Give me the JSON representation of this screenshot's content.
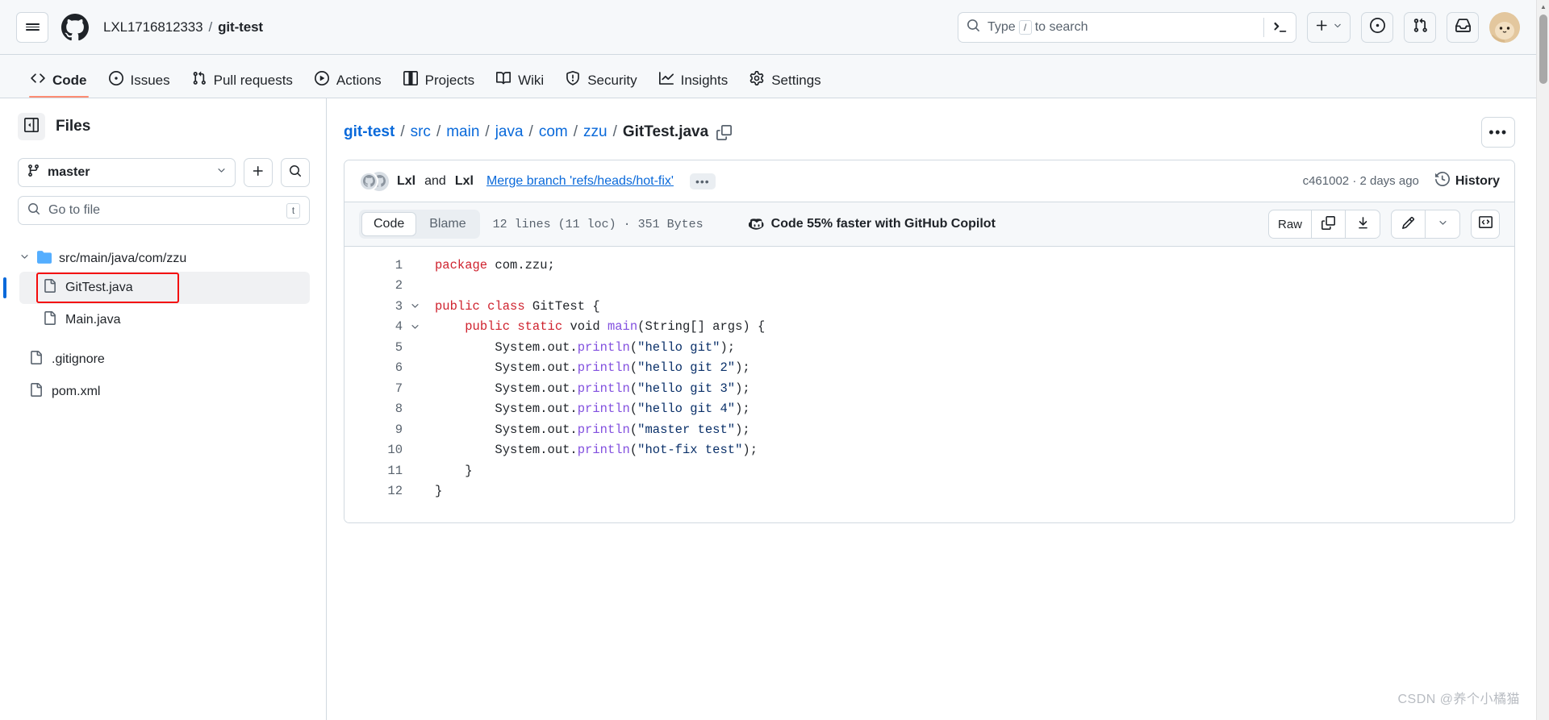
{
  "header": {
    "menu_icon": "hamburger-icon",
    "logo_icon": "github-logo-icon",
    "owner": "LXL1716812333",
    "separator": "/",
    "repo": "git-test",
    "search": {
      "icon": "search-icon",
      "placeholder_prefix": "Type",
      "slash_key": "/",
      "placeholder_suffix": "to search",
      "command_icon": "terminal-prompt-icon"
    },
    "actions": [
      {
        "name": "create-new-button",
        "icon": "plus-icon",
        "caret": "chevron-down-icon"
      },
      {
        "name": "issues-button",
        "icon": "issue-opened-icon"
      },
      {
        "name": "pull-requests-button",
        "icon": "git-pull-request-icon"
      },
      {
        "name": "notifications-button",
        "icon": "inbox-icon"
      },
      {
        "name": "user-avatar",
        "icon": "avatar-icon"
      }
    ]
  },
  "repo_nav": {
    "tabs": [
      {
        "label": "Code",
        "icon": "code-icon",
        "active": true
      },
      {
        "label": "Issues",
        "icon": "issue-opened-icon",
        "active": false
      },
      {
        "label": "Pull requests",
        "icon": "git-pull-request-icon",
        "active": false
      },
      {
        "label": "Actions",
        "icon": "play-icon",
        "active": false
      },
      {
        "label": "Projects",
        "icon": "table-icon",
        "active": false
      },
      {
        "label": "Wiki",
        "icon": "book-icon",
        "active": false
      },
      {
        "label": "Security",
        "icon": "shield-icon",
        "active": false
      },
      {
        "label": "Insights",
        "icon": "graph-icon",
        "active": false
      },
      {
        "label": "Settings",
        "icon": "gear-icon",
        "active": false
      }
    ]
  },
  "sidebar": {
    "panel_icon": "sidebar-collapse-icon",
    "title": "Files",
    "branch": {
      "icon": "git-branch-icon",
      "name": "master",
      "caret": "chevron-down-icon"
    },
    "add_file_icon": "plus-icon",
    "search_toggle_icon": "search-icon",
    "file_filter": {
      "icon": "search-icon",
      "placeholder": "Go to file",
      "shortcut": "t"
    },
    "tree": {
      "folder": {
        "label": "src/main/java/com/zzu",
        "chevron": "chevron-down-icon",
        "icon": "folder-icon"
      },
      "folder_files": [
        {
          "label": "GitTest.java",
          "icon": "file-icon",
          "selected": true,
          "annotated": true
        },
        {
          "label": "Main.java",
          "icon": "file-icon",
          "selected": false,
          "annotated": false
        }
      ],
      "root_files": [
        {
          "label": ".gitignore",
          "icon": "file-icon"
        },
        {
          "label": "pom.xml",
          "icon": "file-icon"
        }
      ]
    }
  },
  "main": {
    "breadcrumb": {
      "repo": "git-test",
      "separator": "/",
      "segments": [
        "src",
        "main",
        "java",
        "com",
        "zzu"
      ],
      "current": "GitTest.java",
      "copy_icon": "copy-path-icon"
    },
    "more_options_label": "•••",
    "commit": {
      "avatars_icon": "stacked-avatars-icon",
      "author": "Lxl",
      "conjunction": "and",
      "coauthor": "Lxl",
      "message": "Merge branch 'refs/heads/hot-fix'",
      "expand_label": "•••",
      "sha": "c461002",
      "sha_separator": "·",
      "relative_time": "2 days ago",
      "history_label": "History",
      "history_icon": "history-clock-icon"
    },
    "toolbar": {
      "tabs": [
        {
          "label": "Code",
          "active": true
        },
        {
          "label": "Blame",
          "active": false
        }
      ],
      "file_stats": "12 lines (11 loc) · 351 Bytes",
      "copilot": {
        "icon": "copilot-icon",
        "label": "Code 55% faster with GitHub Copilot"
      },
      "raw_label": "Raw",
      "copy_icon": "copy-icon",
      "download_icon": "download-icon",
      "edit_icon": "pencil-icon",
      "edit_caret_icon": "chevron-down-icon",
      "symbols_icon": "code-brackets-icon"
    },
    "code": {
      "language": "java",
      "lines": [
        {
          "n": "1",
          "fold": false,
          "tokens": [
            {
              "t": "    ",
              "c": ""
            },
            {
              "t": "package",
              "c": "k"
            },
            {
              "t": " com.zzu;",
              "c": ""
            }
          ]
        },
        {
          "n": "2",
          "fold": false,
          "tokens": []
        },
        {
          "n": "3",
          "fold": true,
          "tokens": [
            {
              "t": "    ",
              "c": ""
            },
            {
              "t": "public class",
              "c": "k"
            },
            {
              "t": " GitTest {",
              "c": ""
            }
          ]
        },
        {
          "n": "4",
          "fold": true,
          "tokens": [
            {
              "t": "        ",
              "c": ""
            },
            {
              "t": "public static",
              "c": "k"
            },
            {
              "t": " void ",
              "c": ""
            },
            {
              "t": "main",
              "c": "fn"
            },
            {
              "t": "(String[] args) {",
              "c": ""
            }
          ]
        },
        {
          "n": "5",
          "fold": false,
          "tokens": [
            {
              "t": "            System.out.",
              "c": ""
            },
            {
              "t": "println",
              "c": "fn"
            },
            {
              "t": "(",
              "c": ""
            },
            {
              "t": "\"hello git\"",
              "c": "s"
            },
            {
              "t": ");",
              "c": ""
            }
          ]
        },
        {
          "n": "6",
          "fold": false,
          "tokens": [
            {
              "t": "            System.out.",
              "c": ""
            },
            {
              "t": "println",
              "c": "fn"
            },
            {
              "t": "(",
              "c": ""
            },
            {
              "t": "\"hello git 2\"",
              "c": "s"
            },
            {
              "t": ");",
              "c": ""
            }
          ]
        },
        {
          "n": "7",
          "fold": false,
          "tokens": [
            {
              "t": "            System.out.",
              "c": ""
            },
            {
              "t": "println",
              "c": "fn"
            },
            {
              "t": "(",
              "c": ""
            },
            {
              "t": "\"hello git 3\"",
              "c": "s"
            },
            {
              "t": ");",
              "c": ""
            }
          ]
        },
        {
          "n": "8",
          "fold": false,
          "tokens": [
            {
              "t": "            System.out.",
              "c": ""
            },
            {
              "t": "println",
              "c": "fn"
            },
            {
              "t": "(",
              "c": ""
            },
            {
              "t": "\"hello git 4\"",
              "c": "s"
            },
            {
              "t": ");",
              "c": ""
            }
          ]
        },
        {
          "n": "9",
          "fold": false,
          "tokens": [
            {
              "t": "            System.out.",
              "c": ""
            },
            {
              "t": "println",
              "c": "fn"
            },
            {
              "t": "(",
              "c": ""
            },
            {
              "t": "\"master test\"",
              "c": "s"
            },
            {
              "t": ");",
              "c": ""
            }
          ]
        },
        {
          "n": "10",
          "fold": false,
          "tokens": [
            {
              "t": "            System.out.",
              "c": ""
            },
            {
              "t": "println",
              "c": "fn"
            },
            {
              "t": "(",
              "c": ""
            },
            {
              "t": "\"hot-fix test\"",
              "c": "s"
            },
            {
              "t": ");",
              "c": ""
            }
          ]
        },
        {
          "n": "11",
          "fold": false,
          "tokens": [
            {
              "t": "        }",
              "c": ""
            }
          ]
        },
        {
          "n": "12",
          "fold": false,
          "tokens": [
            {
              "t": "    }",
              "c": ""
            }
          ]
        }
      ]
    }
  },
  "watermark": "CSDN @养个小橘猫",
  "colors": {
    "accent": "#0969da",
    "tab_underline": "#fd8c73",
    "annotation_box": "#f40b0b",
    "keyword": "#cf222e",
    "function": "#8250df",
    "string": "#0a3069",
    "header_bg": "#f6f8fa",
    "border": "#d1d9e0"
  }
}
